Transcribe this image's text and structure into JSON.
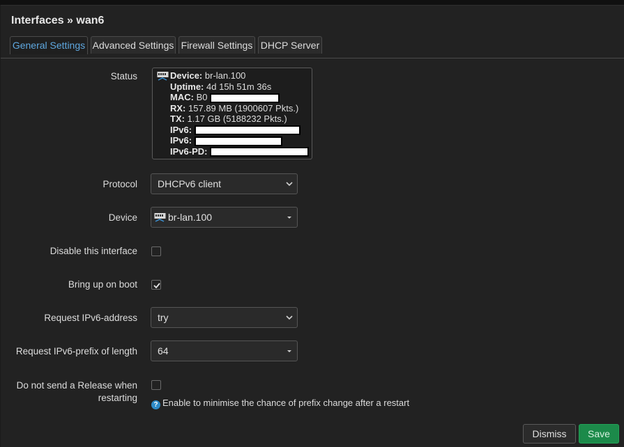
{
  "dialog": {
    "title": "Interfaces » wan6"
  },
  "tabs": [
    {
      "label": "General Settings",
      "active": true
    },
    {
      "label": "Advanced Settings",
      "active": false
    },
    {
      "label": "Firewall Settings",
      "active": false
    },
    {
      "label": "DHCP Server",
      "active": false
    }
  ],
  "status": {
    "label": "Status",
    "device_key": "Device:",
    "device_val": "br-lan.100",
    "uptime_key": "Uptime:",
    "uptime_val": "4d 15h 51m 36s",
    "mac_key": "MAC:",
    "mac_val": "B0",
    "rx_key": "RX:",
    "rx_val": "157.89 MB (1900607 Pkts.)",
    "tx_key": "TX:",
    "tx_val": "1.17 GB (5188232 Pkts.)",
    "ipv6_key": "IPv6:",
    "ipv6pd_key": "IPv6-PD:"
  },
  "protocol": {
    "label": "Protocol",
    "value": "DHCPv6 client"
  },
  "device": {
    "label": "Device",
    "value": "br-lan.100",
    "icon": "network-port-icon"
  },
  "disable_interface": {
    "label": "Disable this interface",
    "checked": false
  },
  "bring_up_on_boot": {
    "label": "Bring up on boot",
    "checked": true
  },
  "request_ipv6_address": {
    "label": "Request IPv6-address",
    "value": "try"
  },
  "request_ipv6_prefix": {
    "label": "Request IPv6-prefix of length",
    "value": "64"
  },
  "no_release": {
    "label_line1": "Do not send a Release when",
    "label_line2": "restarting",
    "checked": false,
    "help": "Enable to minimise the chance of prefix change after a restart"
  },
  "buttons": {
    "dismiss": "Dismiss",
    "save": "Save"
  },
  "colors": {
    "accent": "#5fa8e0",
    "save": "#1c8a4a",
    "background": "#222222"
  }
}
